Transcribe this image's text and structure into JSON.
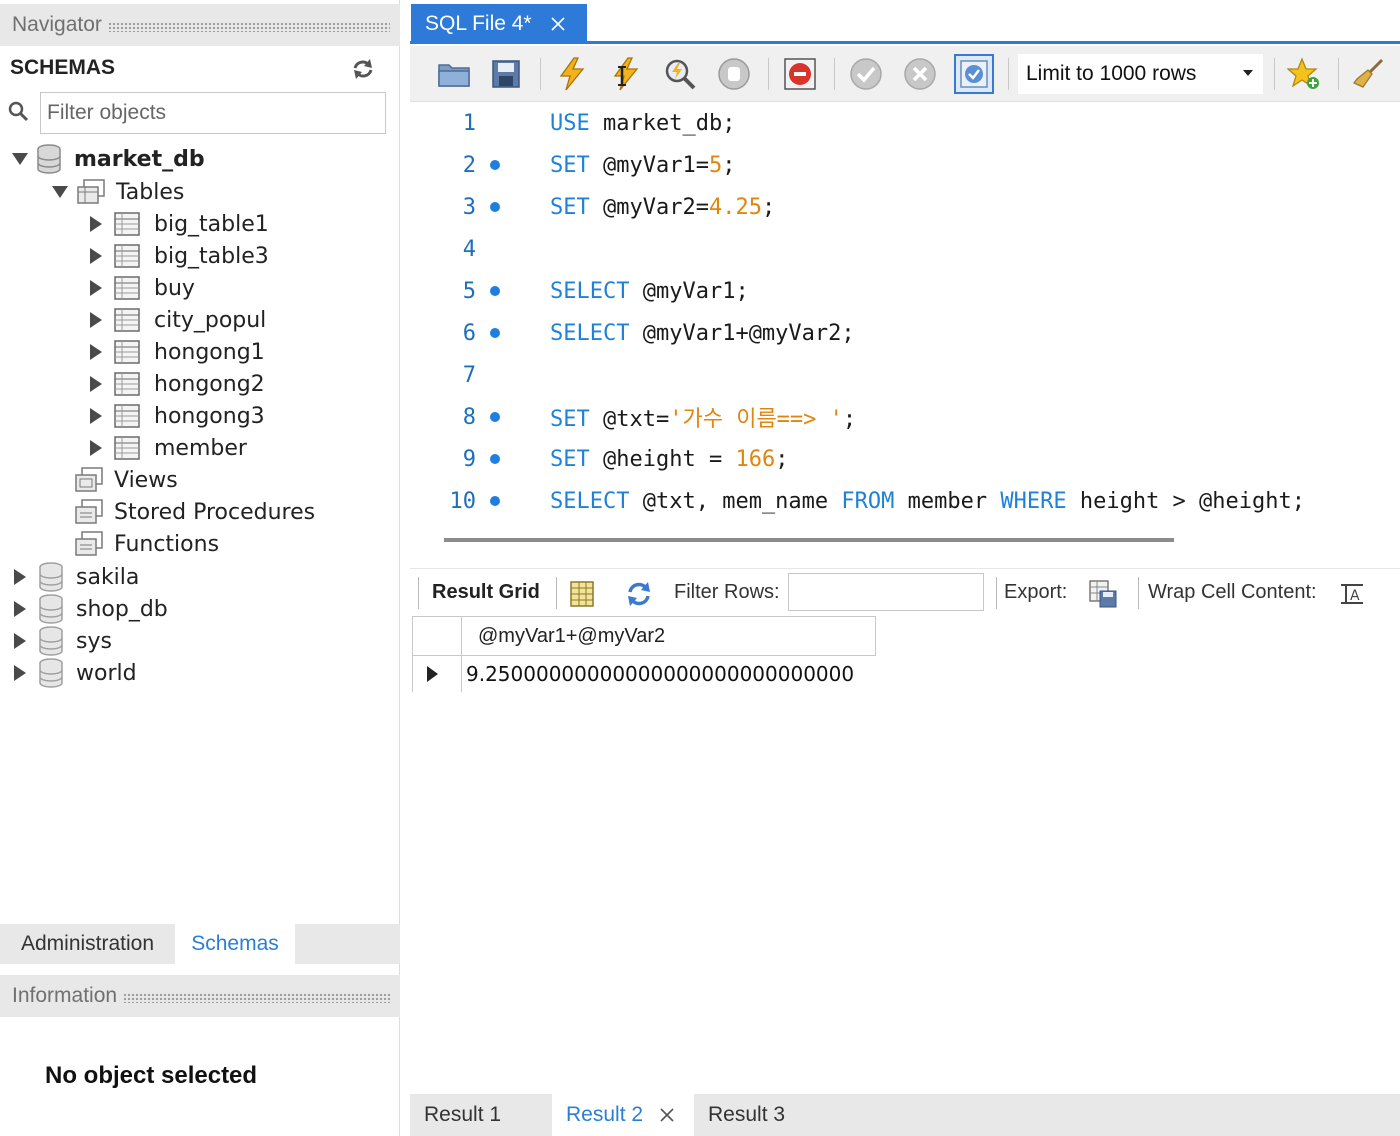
{
  "navigator": {
    "header": "Navigator",
    "schemas_title": "SCHEMAS",
    "filter_placeholder": "Filter objects",
    "tree": {
      "market_db": "market_db",
      "tables_group": "Tables",
      "tables": [
        "big_table1",
        "big_table3",
        "buy",
        "city_popul",
        "hongong1",
        "hongong2",
        "hongong3",
        "member"
      ],
      "views_group": "Views",
      "procedures_group": "Stored Procedures",
      "functions_group": "Functions",
      "other_schemas": [
        "sakila",
        "shop_db",
        "sys",
        "world"
      ]
    },
    "bottom_tabs": {
      "administration": "Administration",
      "schemas": "Schemas"
    },
    "info_header": "Information",
    "no_object": "No object selected"
  },
  "editor": {
    "tab_title": "SQL File 4*",
    "limit_label": "Limit to 1000 rows",
    "lines": [
      {
        "n": "1",
        "dot": false
      },
      {
        "n": "2",
        "dot": true
      },
      {
        "n": "3",
        "dot": true
      },
      {
        "n": "4",
        "dot": false
      },
      {
        "n": "5",
        "dot": true
      },
      {
        "n": "6",
        "dot": true
      },
      {
        "n": "7",
        "dot": false
      },
      {
        "n": "8",
        "dot": true
      },
      {
        "n": "9",
        "dot": true
      },
      {
        "n": "10",
        "dot": true
      }
    ],
    "code": {
      "l1_kw": "USE",
      "l1_rest": " market_db;",
      "l2_kw": "SET",
      "l2_a": " @myVar1=",
      "l2_num": "5",
      "l2_end": ";",
      "l3_kw": "SET",
      "l3_a": " @myVar2=",
      "l3_num": "4.25",
      "l3_end": ";",
      "l5_kw": "SELECT",
      "l5_rest": " @myVar1;",
      "l6_kw": "SELECT",
      "l6_rest": " @myVar1+@myVar2;",
      "l8_kw": "SET",
      "l8_a": " @txt=",
      "l8_str": "'가수 이름==> '",
      "l8_end": ";",
      "l9_kw": "SET",
      "l9_a": " @height = ",
      "l9_num": "166",
      "l9_end": ";",
      "l10_kw": "SELECT",
      "l10_a": " @txt, mem_name ",
      "l10_kw2": "FROM",
      "l10_b": " member ",
      "l10_kw3": "WHERE",
      "l10_c": " height > @height;"
    }
  },
  "results": {
    "result_grid_label": "Result Grid",
    "filter_rows_label": "Filter Rows:",
    "export_label": "Export:",
    "wrap_label": "Wrap Cell Content:",
    "column_header": "@myVar1+@myVar2",
    "cell_value": "9.25000000000000000000000000000",
    "tabs": [
      "Result 1",
      "Result 2",
      "Result 3"
    ]
  },
  "colors": {
    "accent": "#2d7ad8",
    "keyword": "#1e82d8",
    "literal": "#e0850e"
  }
}
